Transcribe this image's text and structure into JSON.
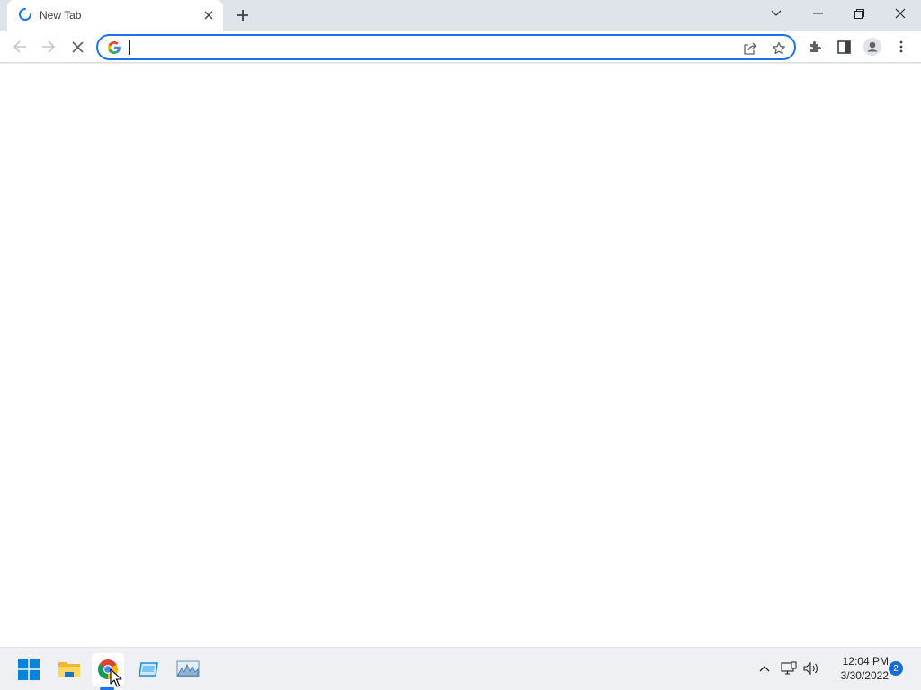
{
  "browser": {
    "tab": {
      "title": "New Tab",
      "state": "loading"
    },
    "new_tab_symbol": "+",
    "window_controls": [
      "tab-search",
      "minimize",
      "restore",
      "close"
    ],
    "toolbar": {
      "back": "back-arrow-icon",
      "forward": "forward-arrow-icon",
      "stop": "stop-icon"
    },
    "omnibox": {
      "value": "",
      "placeholder": "",
      "search_engine_icon": "google-g-icon"
    },
    "omnibox_actions": [
      "share-icon",
      "bookmark-star-icon"
    ],
    "right_toolbar": [
      "extensions-icon",
      "side-panel-icon",
      "profile-icon",
      "menu-icon"
    ],
    "accent_color": "#1a73e8"
  },
  "taskbar": {
    "apps": [
      "windows-start",
      "file-explorer",
      "chrome",
      "app-blue-window",
      "resource-monitor"
    ],
    "active_app": "chrome",
    "tray": [
      "show-hidden-icons-chevron",
      "network-icon",
      "volume-icon"
    ],
    "time": "12:04 PM",
    "date": "3/30/2022",
    "notifications": "2"
  }
}
